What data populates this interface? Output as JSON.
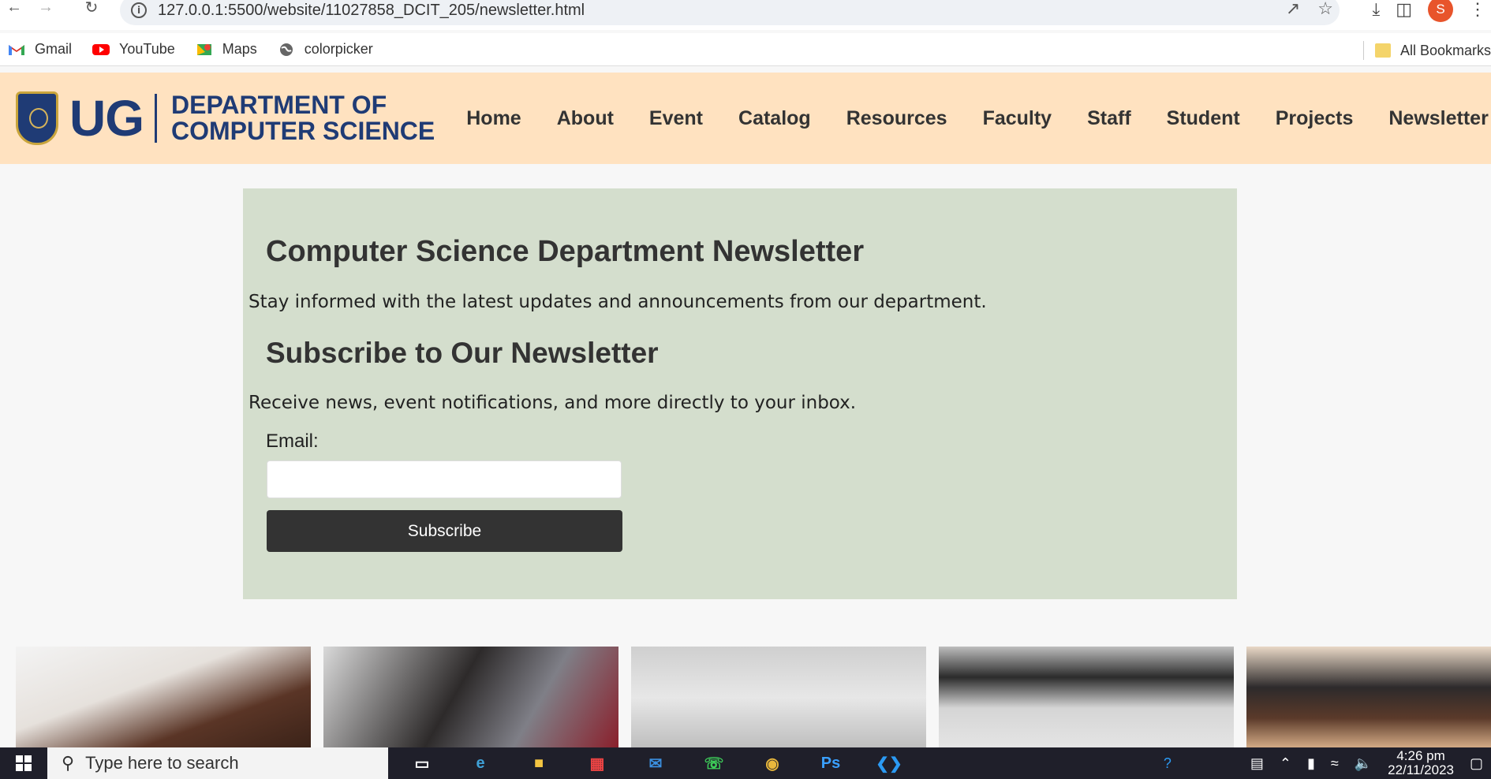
{
  "browser": {
    "url": "127.0.0.1:5500/website/11027858_DCIT_205/newsletter.html",
    "bookmarks": [
      {
        "label": "Gmail",
        "icon": "gmail-icon"
      },
      {
        "label": "YouTube",
        "icon": "youtube-icon"
      },
      {
        "label": "Maps",
        "icon": "maps-icon"
      },
      {
        "label": "colorpicker",
        "icon": "globe-icon"
      }
    ],
    "all_bookmarks": "All Bookmarks",
    "profile_initial": "S"
  },
  "site": {
    "logo_short": "UG",
    "dept_line1": "DEPARTMENT OF",
    "dept_line2": "COMPUTER SCIENCE",
    "nav": [
      "Home",
      "About",
      "Event",
      "Catalog",
      "Resources",
      "Faculty",
      "Staff",
      "Student",
      "Projects",
      "Newsletter"
    ]
  },
  "newsletter": {
    "title": "Computer Science Department Newsletter",
    "intro": "Stay informed with the latest updates and announcements from our department.",
    "subscribe_title": "Subscribe to Our Newsletter",
    "subscribe_text": "Receive news, event notifications, and more directly to your inbox.",
    "email_label": "Email:",
    "email_value": "",
    "button_label": "Subscribe"
  },
  "taskbar": {
    "search_placeholder": "Type here to search",
    "time": "4:26 pm",
    "date": "22/11/2023"
  },
  "colors": {
    "header_bg": "#ffe2c0",
    "brand_blue": "#1f3b75",
    "panel_bg": "#d4decd",
    "button_bg": "#333333"
  }
}
